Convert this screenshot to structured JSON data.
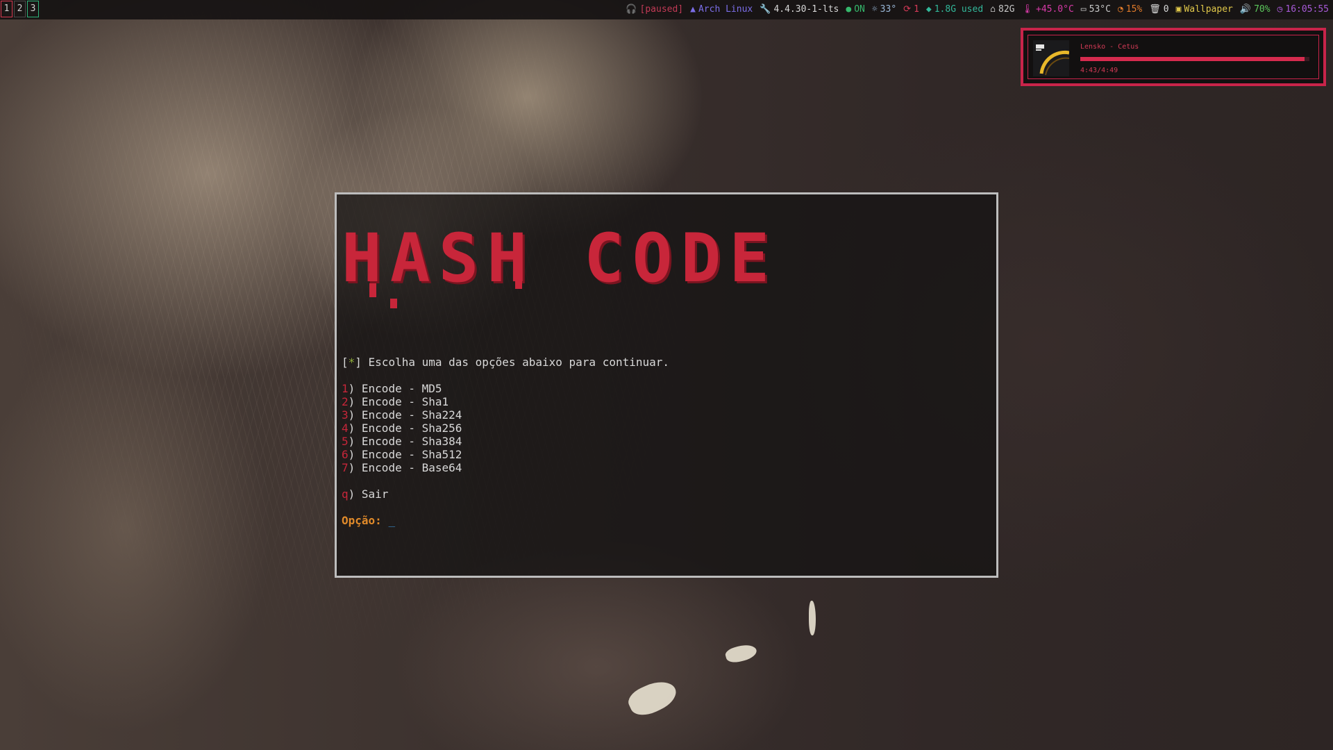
{
  "workspaces": [
    "1",
    "2",
    "3"
  ],
  "status_bar": {
    "music": "[paused]",
    "os": "Arch Linux",
    "kernel": "4.4.30-1-lts",
    "network": "ON",
    "weather": "33°",
    "updates": "1",
    "memory": "1.8G used",
    "disk": "82G",
    "cpu_temp": "+45.0°C",
    "gpu_temp": "53°C",
    "cpu_load": "15%",
    "trash": "0",
    "wallpaper": "Wallpaper",
    "volume": "70%",
    "clock": "16:05:55"
  },
  "colors": {
    "accent_red": "#c8263a",
    "workspace_active": "#d83a52",
    "workspace_other": "#2fb37a",
    "music_border": "#c8244a"
  },
  "player": {
    "track": "Lensko - Cetus",
    "time": "4:43/4:49",
    "progress": 0.98
  },
  "terminal": {
    "banner": "HASH CODE",
    "intro_bracket_open": "[",
    "intro_star": "*",
    "intro_text": "] Escolha uma das opções abaixo para continuar.",
    "options": [
      {
        "key": "1",
        "label": ") Encode - MD5"
      },
      {
        "key": "2",
        "label": ") Encode - Sha1"
      },
      {
        "key": "3",
        "label": ") Encode - Sha224"
      },
      {
        "key": "4",
        "label": ") Encode - Sha256"
      },
      {
        "key": "5",
        "label": ") Encode - Sha384"
      },
      {
        "key": "6",
        "label": ") Encode - Sha512"
      },
      {
        "key": "7",
        "label": ") Encode - Base64"
      }
    ],
    "quit_key": "q",
    "quit_label": ") Sair",
    "prompt": "Opção:",
    "cursor": "_"
  }
}
